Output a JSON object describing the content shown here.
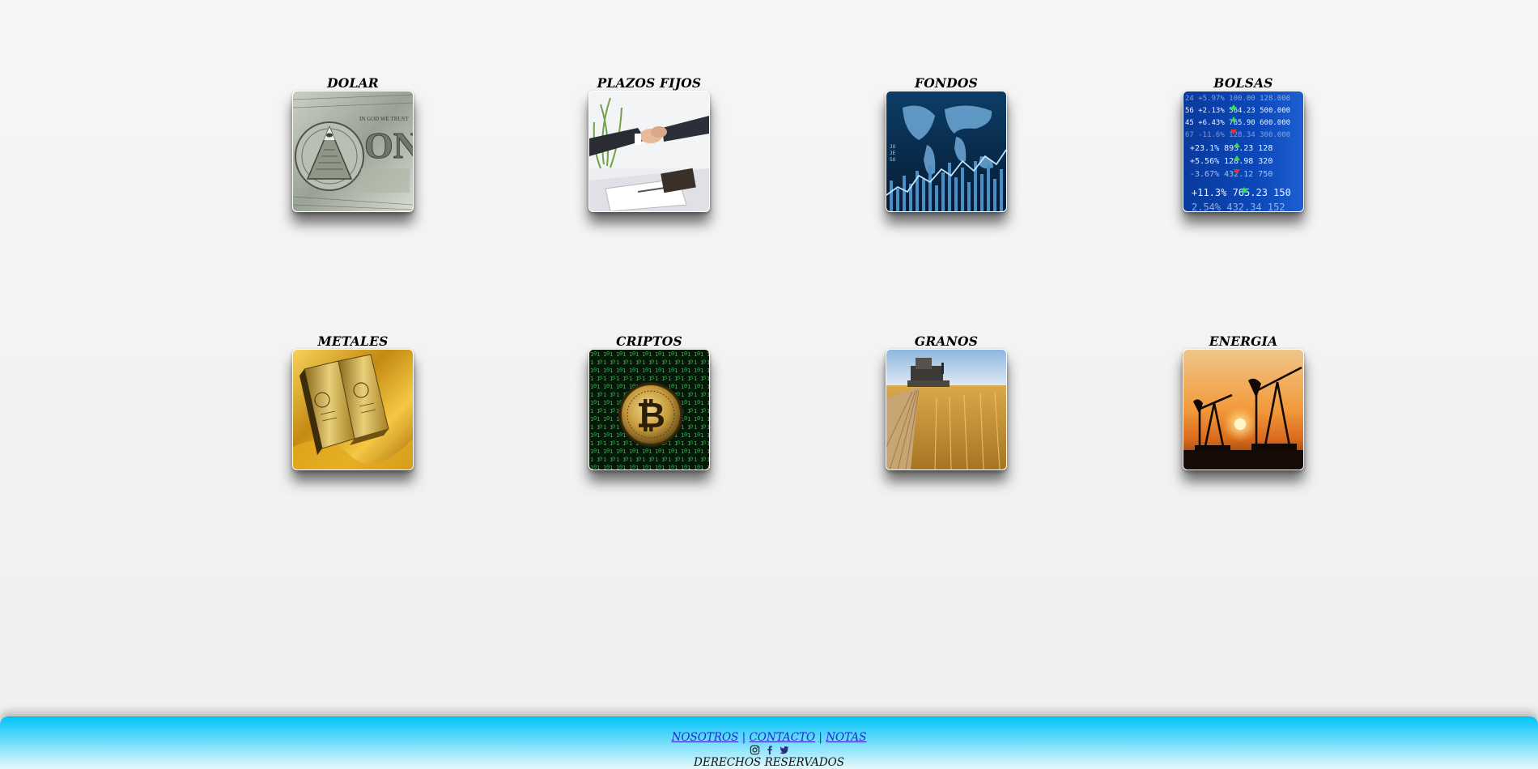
{
  "tiles": [
    {
      "title": "DOLAR",
      "image": "dollar-bill-image"
    },
    {
      "title": "PLAZOS FIJOS",
      "image": "handshake-image"
    },
    {
      "title": "FONDOS",
      "image": "world-chart-image"
    },
    {
      "title": "BOLSAS",
      "image": "stock-board-image"
    },
    {
      "title": "METALES",
      "image": "gold-bars-image"
    },
    {
      "title": "CRIPTOS",
      "image": "bitcoin-image"
    },
    {
      "title": "GRANOS",
      "image": "wheat-harvest-image"
    },
    {
      "title": "ENERGIA",
      "image": "oil-pumps-image"
    }
  ],
  "footer": {
    "links": [
      "NOSOTROS",
      "CONTACTO",
      "NOTAS"
    ],
    "separator": "|",
    "icons": [
      "instagram-icon",
      "facebook-icon",
      "twitter-icon"
    ],
    "rights": "DERECHOS RESERVADOS",
    "accent": "#00c3f8",
    "link_color": "#2a1fd6"
  },
  "stock_board": {
    "rows": [
      "24 +5.97% 100.00 128.000",
      "56 +2.13% 564.23 500.000",
      "45 +6.43% 765.90 600.000",
      "67 -11.6% 128.34 300.000",
      "+23.1% 893.23 128",
      "+5.56% 128.98 320",
      "-3.67% 432.12 750",
      "+11.3% 765.23 150",
      "2.54% 432.34 152"
    ]
  }
}
